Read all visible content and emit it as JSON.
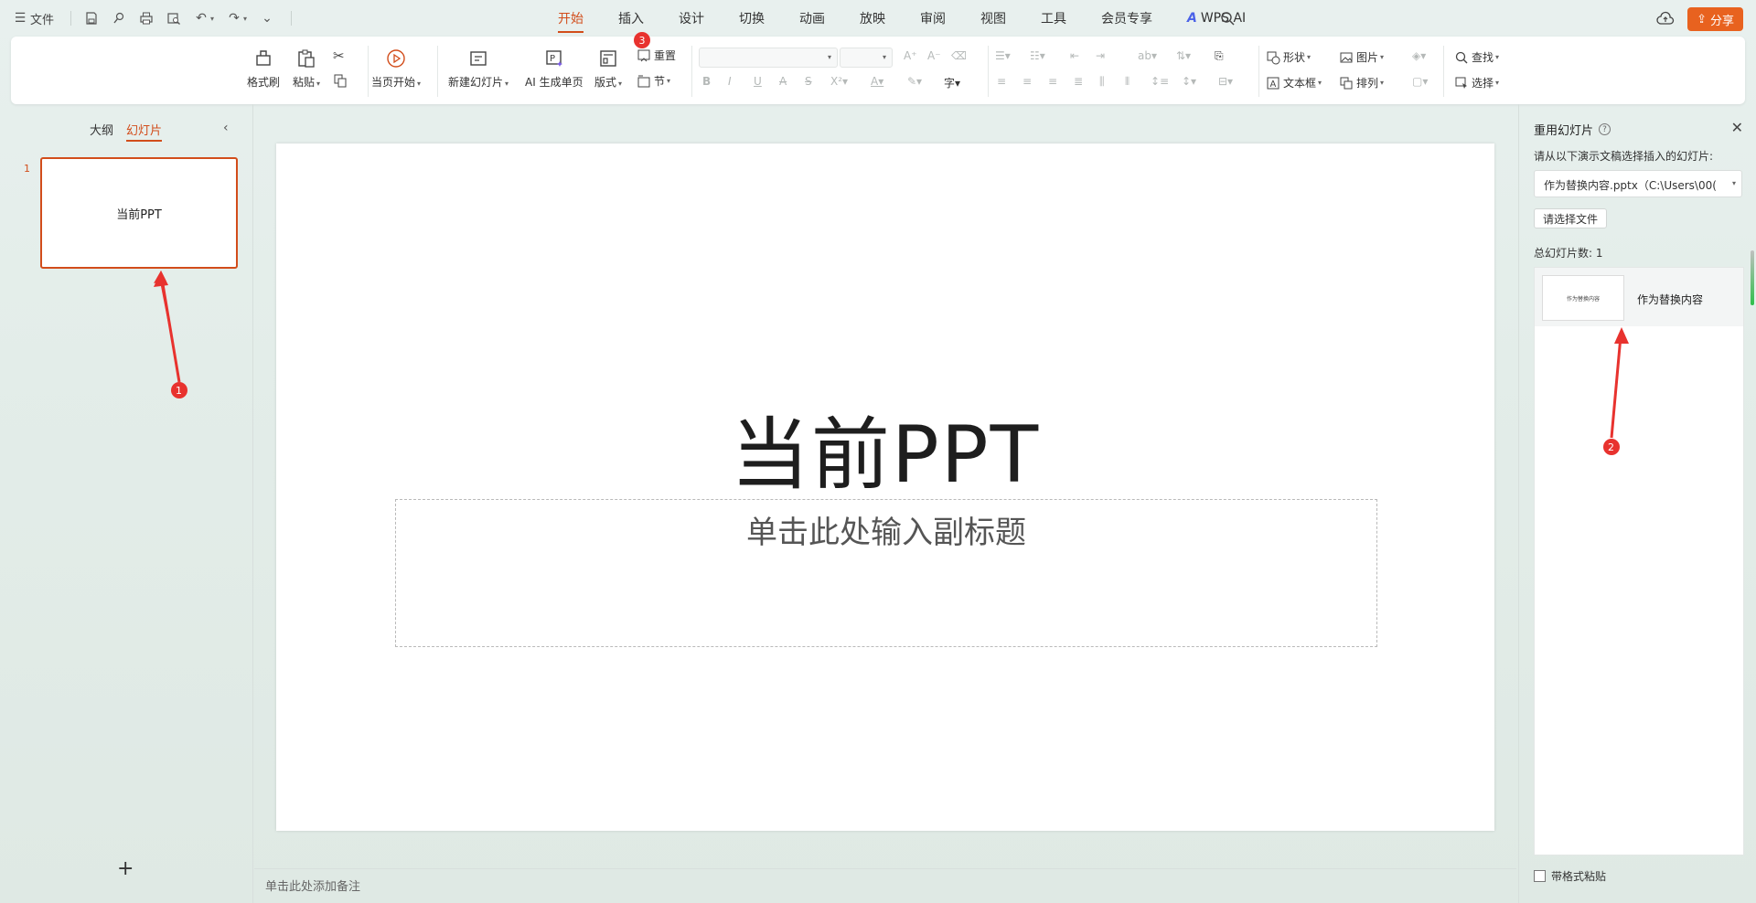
{
  "menubar": {
    "file_label": "文件",
    "tabs": [
      "开始",
      "插入",
      "设计",
      "切换",
      "动画",
      "放映",
      "审阅",
      "视图",
      "工具",
      "会员专享",
      "WPS AI"
    ],
    "share_label": "分享"
  },
  "ribbon": {
    "format_painter": "格式刷",
    "paste": "粘贴",
    "play_from_current": "当页开始",
    "new_slide": "新建幻灯片",
    "ai_slide": "AI 生成单页",
    "layout": "版式",
    "reset": "重置",
    "section": "节",
    "shape": "形状",
    "picture": "图片",
    "find": "查找",
    "textbox": "文本框",
    "arrange": "排列",
    "select": "选择"
  },
  "left_panel": {
    "tab_outline": "大纲",
    "tab_slides": "幻灯片",
    "slide_number": "1",
    "slide_thumb_text": "当前PPT"
  },
  "slide": {
    "title": "当前PPT",
    "subtitle_placeholder": "单击此处输入副标题"
  },
  "notes_placeholder": "单击此处添加备注",
  "reuse_pane": {
    "title": "重用幻灯片",
    "instruction": "请从以下演示文稿选择插入的幻灯片:",
    "file_value": "作为替换内容.pptx（C:\\Users\\00(",
    "choose_file": "请选择文件",
    "total_count": "总幻灯片数: 1",
    "items": [
      {
        "thumb_text": "作为替换内容",
        "name": "作为替换内容"
      }
    ],
    "keep_format": "带格式粘贴"
  },
  "annotations": {
    "marker1": "1",
    "marker2": "2",
    "marker3": "3"
  },
  "colors": {
    "accent": "#d24d1b",
    "share": "#e8621f",
    "annotation": "#e8322e"
  }
}
